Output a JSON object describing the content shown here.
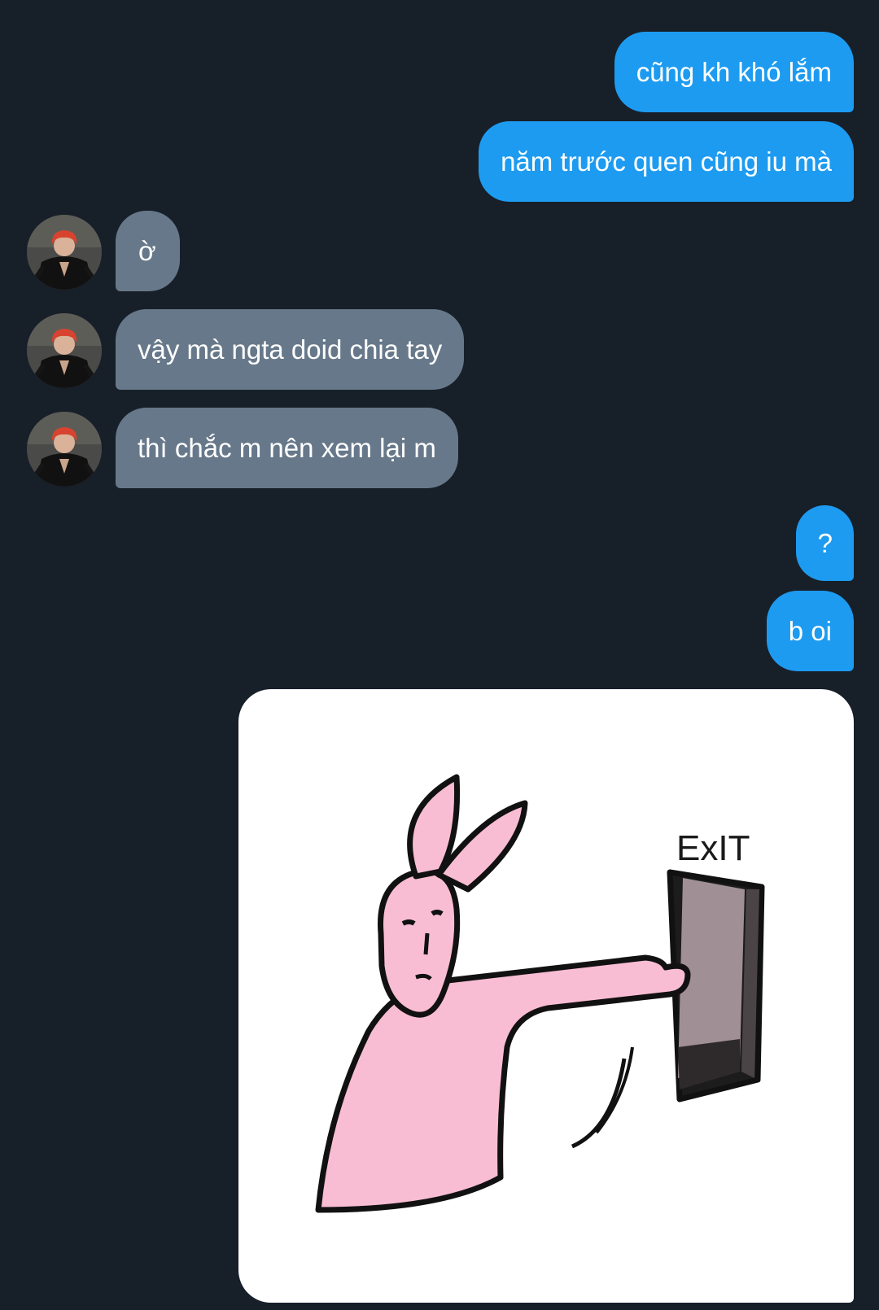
{
  "messages": [
    {
      "id": "m1",
      "from": "me",
      "text": "cũng kh khó lắm"
    },
    {
      "id": "m2",
      "from": "me",
      "text": "năm trước quen cũng iu mà"
    },
    {
      "id": "m3",
      "from": "them",
      "text": "ờ"
    },
    {
      "id": "m4",
      "from": "them",
      "text": "vậy mà ngta doid chia tay"
    },
    {
      "id": "m5",
      "from": "them",
      "text": "thì chắc m nên xem lại m"
    },
    {
      "id": "m6",
      "from": "me",
      "text": "?"
    },
    {
      "id": "m7",
      "from": "me",
      "text": "b oi"
    }
  ],
  "sticker": {
    "from": "me",
    "sign_text": "ExIT",
    "subject": "pink-rabbit-exit-door"
  },
  "colors": {
    "background": "#171f29",
    "sent_bubble": "#1d9bf0",
    "received_bubble": "#67788a",
    "text": "#ffffff"
  }
}
